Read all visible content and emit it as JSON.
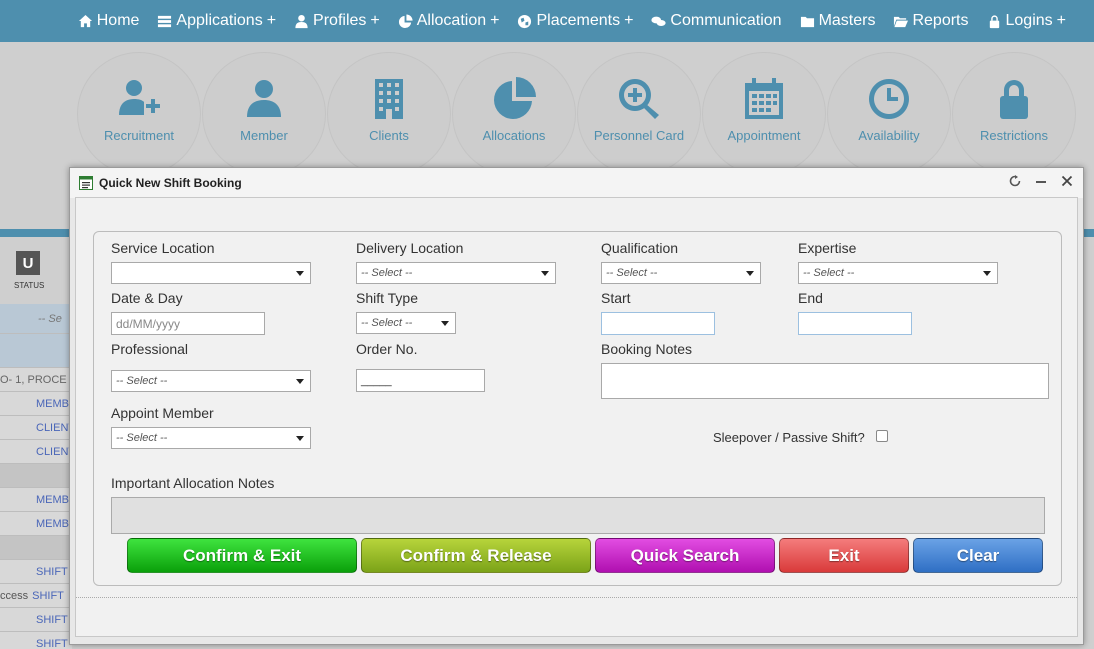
{
  "nav": {
    "items": [
      {
        "label": "Home",
        "icon": "home-icon",
        "plus": false
      },
      {
        "label": "Applications",
        "icon": "list-icon",
        "plus": true
      },
      {
        "label": "Profiles",
        "icon": "user-icon",
        "plus": true
      },
      {
        "label": "Allocation",
        "icon": "pie-icon",
        "plus": true
      },
      {
        "label": "Placements",
        "icon": "globe-icon",
        "plus": true
      },
      {
        "label": "Communication",
        "icon": "chat-icon",
        "plus": false
      },
      {
        "label": "Masters",
        "icon": "folder-icon",
        "plus": false
      },
      {
        "label": "Reports",
        "icon": "folder-open-icon",
        "plus": false
      },
      {
        "label": "Logins",
        "icon": "lock-icon",
        "plus": true
      }
    ],
    "plus_symbol": "+"
  },
  "tiles": [
    {
      "label": "Recruitment",
      "icon": "add-user-icon"
    },
    {
      "label": "Member",
      "icon": "user-icon"
    },
    {
      "label": "Clients",
      "icon": "building-icon"
    },
    {
      "label": "Allocations",
      "icon": "pie-chart-icon"
    },
    {
      "label": "Personnel Card",
      "icon": "search-plus-icon"
    },
    {
      "label": "Appointment",
      "icon": "calendar-icon"
    },
    {
      "label": "Availability",
      "icon": "clock-icon"
    },
    {
      "label": "Restrictions",
      "icon": "lock-icon"
    }
  ],
  "background": {
    "status_letter": "U",
    "status_label": "STATUS",
    "search_placeholder": "-- Se",
    "proc_text": "O- 1, PROCE",
    "access_text": "ccess",
    "rows": [
      "MEMB",
      "CLIENT",
      "CLIENT",
      "MEMB",
      "MEMB",
      "SHIFT",
      "SHIFT",
      "SHIFT",
      "SHIFT"
    ]
  },
  "dialog": {
    "title": "Quick New Shift Booking",
    "form": {
      "service_location_label": "Service Location",
      "service_location_value": "",
      "delivery_location_label": "Delivery Location",
      "delivery_location_value": "-- Select --",
      "qualification_label": "Qualification",
      "qualification_value": "-- Select --",
      "expertise_label": "Expertise",
      "expertise_value": "-- Select --",
      "date_day_label": "Date & Day",
      "date_placeholder": "dd/MM/yyyy",
      "shift_type_label": "Shift Type",
      "shift_type_value": "-- Select --",
      "start_label": "Start",
      "start_value": "",
      "end_label": "End",
      "end_value": "",
      "professional_label": "Professional",
      "professional_value": "-- Select --",
      "order_no_label": "Order No.",
      "order_no_value": "_____",
      "booking_notes_label": "Booking Notes",
      "appoint_member_label": "Appoint Member",
      "appoint_member_value": "-- Select --",
      "sleepover_label": "Sleepover / Passive Shift?",
      "important_notes_label": "Important Allocation Notes"
    },
    "buttons": {
      "confirm_exit": "Confirm & Exit",
      "confirm_release": "Confirm & Release",
      "quick_search": "Quick Search",
      "exit": "Exit",
      "clear": "Clear"
    },
    "colors": {
      "confirm_exit": "#1cc21c",
      "confirm_release": "#9bbd2a",
      "quick_search": "#cc22cc",
      "exit": "#e85a5a",
      "clear": "#4a88d6"
    }
  },
  "theme": {
    "nav_bg": "#4e8fae",
    "tile_icon": "#4e8fae"
  }
}
